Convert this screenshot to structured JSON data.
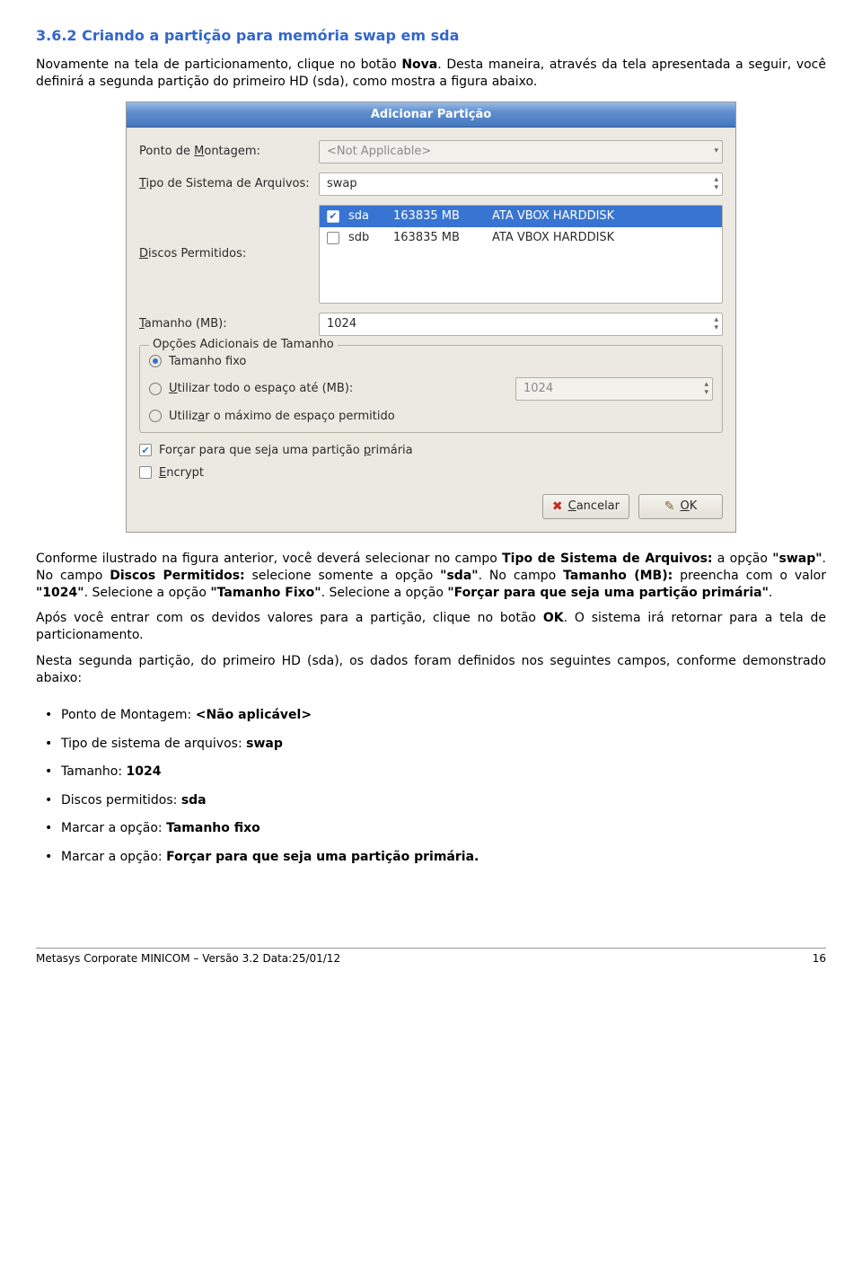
{
  "section_title": "3.6.2 Criando a partição para memória swap em sda",
  "intro": {
    "p1a": "Novamente na tela de particionamento, clique no botão ",
    "p1b": "Nova",
    "p1c": ". Desta maneira, através da tela apresentada a seguir, você definirá a segunda partição do primeiro HD (sda), como mostra a figura abaixo."
  },
  "dialog": {
    "title": "Adicionar Partição",
    "mount_label_pre": "Ponto de ",
    "mount_label_u": "M",
    "mount_label_post": "ontagem:",
    "mount_value": "<Not Applicable>",
    "fstype_label_u": "T",
    "fstype_label_post": "ipo de Sistema de Arquivos:",
    "fstype_value": "swap",
    "allowed_label_u": "D",
    "allowed_label_post": "iscos Permitidos:",
    "disks": [
      {
        "checked": true,
        "name": "sda",
        "size": "163835 MB",
        "model": "ATA VBOX HARDDISK"
      },
      {
        "checked": false,
        "name": "sdb",
        "size": "163835 MB",
        "model": "ATA VBOX HARDDISK"
      }
    ],
    "size_label_u": "T",
    "size_label_post": "amanho (MB):",
    "size_value": "1024",
    "group_title": "Opções Adicionais de Tamanho",
    "radio_fixed": "Tamanho fixo",
    "radio_upto_u": "U",
    "radio_upto_post": "tilizar todo o espaço até (MB):",
    "radio_upto_value": "1024",
    "radio_max_pre": "Utiliz",
    "radio_max_u": "a",
    "radio_max_post": "r o máximo de espaço permitido",
    "chk_primary_pre": "Forçar para que seja uma partição ",
    "chk_primary_u": "p",
    "chk_primary_post": "rimária",
    "chk_encrypt_u": "E",
    "chk_encrypt_post": "ncrypt",
    "btn_cancel_u": "C",
    "btn_cancel_post": "ancelar",
    "btn_ok_u": "O",
    "btn_ok_post": "K"
  },
  "after": {
    "p1a": "Conforme ilustrado na figura anterior, você deverá selecionar no campo ",
    "p1b": "Tipo de Sistema de Arquivos:",
    "p1c": " a opção ",
    "p1d": "\"swap\"",
    "p1e": ". No campo ",
    "p1f": "Discos Permitidos:",
    "p1g": " selecione somente a opção ",
    "p1h": "\"sda\"",
    "p1i": ". No campo ",
    "p1j": "Tamanho (MB):",
    "p1k": " preencha com o valor ",
    "p1l": "\"1024\"",
    "p1m": ". Selecione a opção ",
    "p1n": "\"Tamanho Fixo\"",
    "p1o": ". Selecione a opção ",
    "p1p": "\"Forçar para que seja uma partição primária\"",
    "p1q": ".",
    "p2a": "Após você entrar com os devidos valores para a partição, clique no botão ",
    "p2b": "OK",
    "p2c": ". O sistema irá retornar para a tela de particionamento.",
    "p3": "Nesta segunda partição, do primeiro HD (sda), os dados foram definidos nos seguintes campos, conforme demonstrado abaixo:"
  },
  "bullets": {
    "b1a": "Ponto de Montagem: ",
    "b1b": "<Não aplicável>",
    "b2a": "Tipo de sistema de arquivos: ",
    "b2b": "swap",
    "b3a": "Tamanho: ",
    "b3b": "1024",
    "b4a": "Discos permitidos: ",
    "b4b": "sda",
    "b5a": "Marcar a opção: ",
    "b5b": "Tamanho fixo",
    "b6a": "Marcar a opção: ",
    "b6b": "Forçar para que seja uma partição primária."
  },
  "footer": {
    "left": "Metasys Corporate MINICOM – Versão 3.2 Data:25/01/12",
    "right": "16"
  }
}
